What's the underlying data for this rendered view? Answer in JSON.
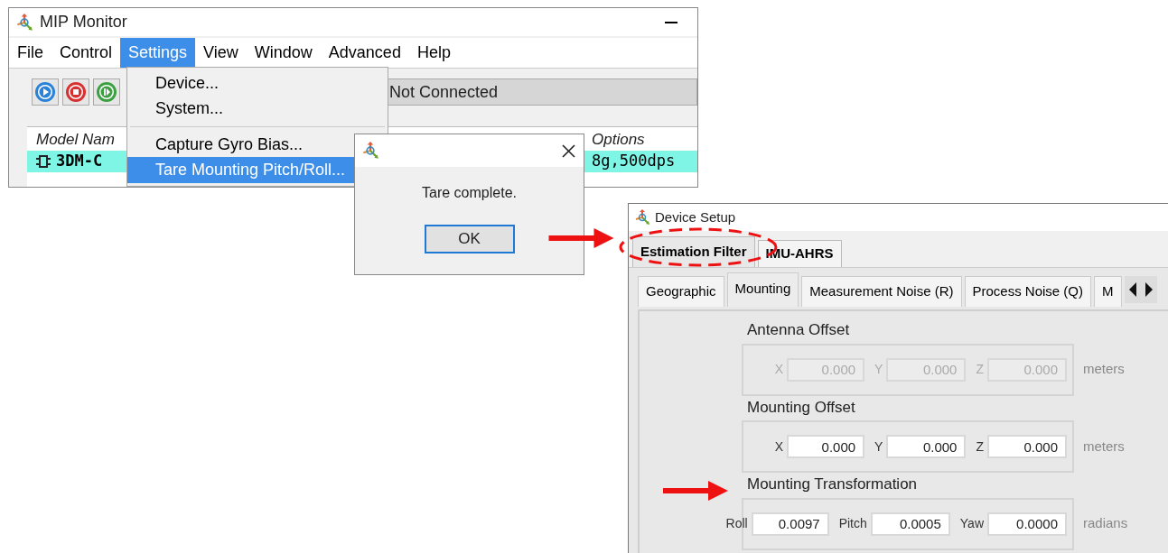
{
  "main_window": {
    "title": "MIP Monitor",
    "menu_bar": [
      {
        "label": "File",
        "selected": false
      },
      {
        "label": "Control",
        "selected": false
      },
      {
        "label": "Settings",
        "selected": true
      },
      {
        "label": "View",
        "selected": false
      },
      {
        "label": "Window",
        "selected": false
      },
      {
        "label": "Advanced",
        "selected": false
      },
      {
        "label": "Help",
        "selected": false
      }
    ],
    "status": "Not Connected",
    "table": {
      "columns": [
        "Model Nam",
        "Options"
      ],
      "rows": [
        {
          "cells": [
            "3DM-C",
            "8g,500dps"
          ],
          "selected": true
        }
      ]
    }
  },
  "settings_menu": [
    {
      "kind": "item",
      "label": "Device...",
      "selected": false
    },
    {
      "kind": "item",
      "label": "System...",
      "selected": false
    },
    {
      "kind": "separator"
    },
    {
      "kind": "item",
      "label": "Capture Gyro Bias...",
      "selected": false
    },
    {
      "kind": "item",
      "label": "Tare Mounting Pitch/Roll...",
      "selected": true
    }
  ],
  "dialog": {
    "message": "Tare complete.",
    "button": "OK"
  },
  "device_setup": {
    "title": "Device Setup",
    "tabs": [
      {
        "label": "Estimation Filter",
        "selected": true
      },
      {
        "label": "IMU-AHRS",
        "selected": false
      }
    ],
    "subtabs": [
      {
        "label": "Geographic",
        "selected": false
      },
      {
        "label": "Mounting",
        "selected": true
      },
      {
        "label": "Measurement Noise (R)",
        "selected": false
      },
      {
        "label": "Process Noise (Q)",
        "selected": false
      },
      {
        "label": "M",
        "selected": false
      }
    ],
    "groups": [
      {
        "title": "Antenna Offset",
        "unit": "meters",
        "fields": [
          {
            "label": "X",
            "value": "0.000",
            "disabled": true
          },
          {
            "label": "Y",
            "value": "0.000",
            "disabled": true
          },
          {
            "label": "Z",
            "value": "0.000",
            "disabled": true
          }
        ]
      },
      {
        "title": "Mounting Offset",
        "unit": "meters",
        "fields": [
          {
            "label": "X",
            "value": "0.000",
            "disabled": false
          },
          {
            "label": "Y",
            "value": "0.000",
            "disabled": false
          },
          {
            "label": "Z",
            "value": "0.000",
            "disabled": false
          }
        ]
      },
      {
        "title": "Mounting Transformation",
        "unit": "radians",
        "fields": [
          {
            "label": "Roll",
            "value": "0.0097",
            "disabled": false
          },
          {
            "label": "Pitch",
            "value": "0.0005",
            "disabled": false
          },
          {
            "label": "Yaw",
            "value": "0.0000",
            "disabled": false
          }
        ]
      }
    ]
  }
}
